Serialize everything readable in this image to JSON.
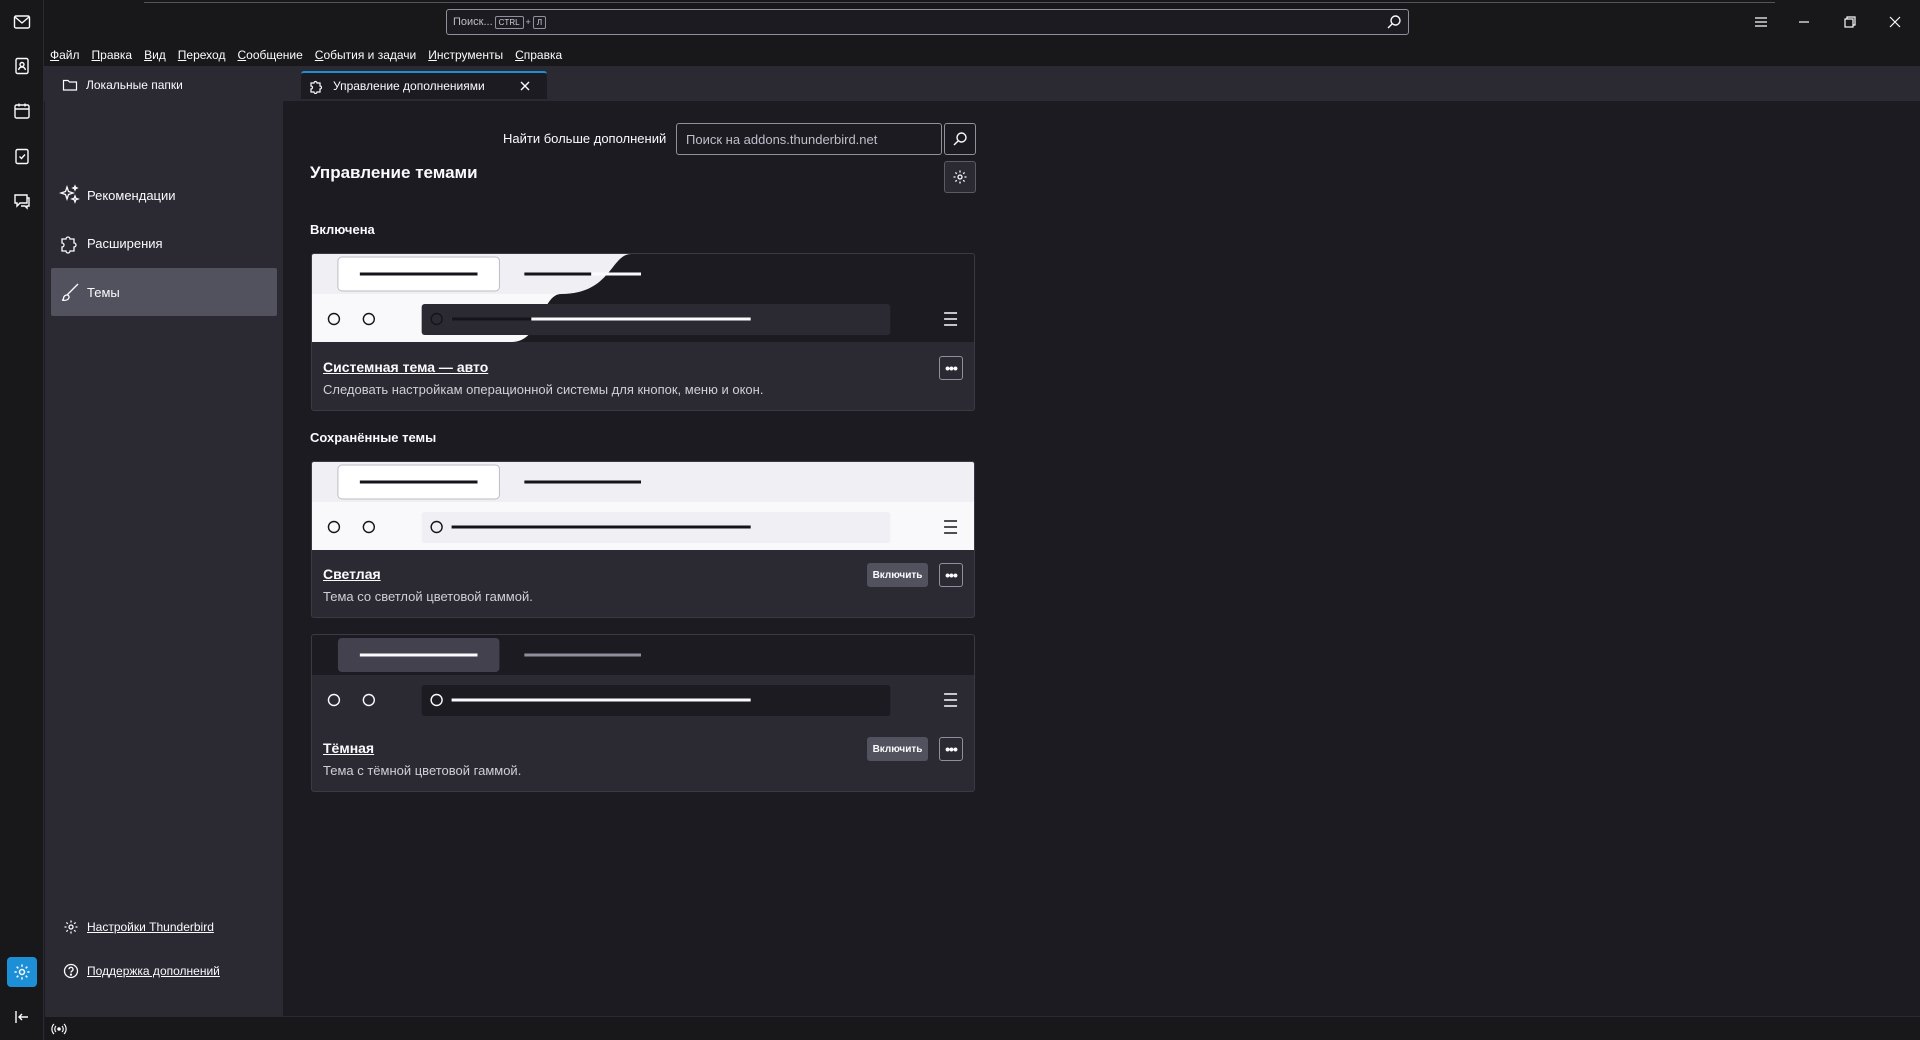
{
  "search": {
    "placeholder": "Поиск...",
    "kbd_ctrl": "CTRL",
    "kbd_plus": "+",
    "kbd_key": "Л"
  },
  "menubar": [
    "Файл",
    "Правка",
    "Вид",
    "Переход",
    "Сообщение",
    "События и задачи",
    "Инструменты",
    "Справка"
  ],
  "tabs": {
    "first": "Локальные папки",
    "selected": "Управление дополнениями"
  },
  "sidebar": {
    "categories": [
      "Рекомендации",
      "Расширения",
      "Темы"
    ],
    "settings_link": "Настройки Thunderbird",
    "support_link": "Поддержка дополнений"
  },
  "main": {
    "find_label": "Найти больше дополнений",
    "find_placeholder": "Поиск на addons.thunderbird.net",
    "title": "Управление темами",
    "enabled_heading": "Включена",
    "saved_heading": "Сохранённые темы",
    "themes": [
      {
        "name": "Системная тема — авто",
        "desc": "Следовать настройкам операционной системы для кнопок, меню и окон."
      },
      {
        "name": "Светлая",
        "desc": "Тема со светлой цветовой гаммой.",
        "enable": "Включить"
      },
      {
        "name": "Тёмная",
        "desc": "Тема с тёмной цветовой гаммой.",
        "enable": "Включить"
      }
    ],
    "more_label": "•••"
  },
  "colors": {
    "accent": "#1d8fd6",
    "bg": "#1c1b22",
    "panel": "#2b2a33"
  }
}
